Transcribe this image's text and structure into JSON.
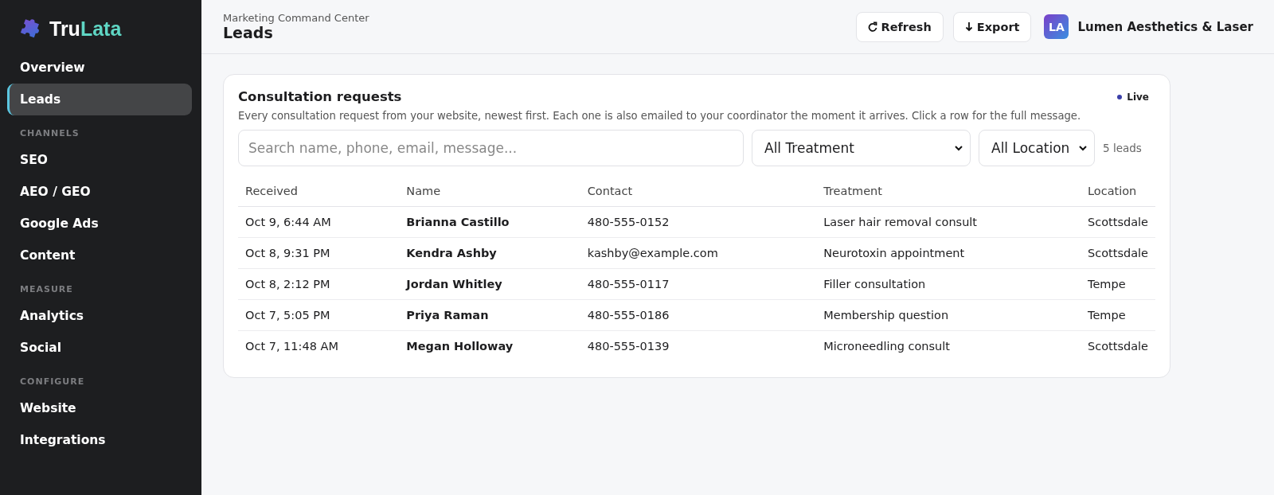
{
  "sidebar": {
    "logo_parts": [
      "Tru",
      "Lata"
    ],
    "sections": [
      {
        "items": [
          {
            "label": "Overview",
            "selected": false
          },
          {
            "label": "Leads",
            "selected": true
          }
        ]
      },
      {
        "heading": "CHANNELS",
        "items": [
          {
            "label": "SEO",
            "selected": false
          },
          {
            "label": "AEO / GEO",
            "selected": false
          },
          {
            "label": "Google Ads",
            "selected": false
          },
          {
            "label": "Content",
            "selected": false
          }
        ]
      },
      {
        "heading": "MEASURE",
        "items": [
          {
            "label": "Analytics",
            "selected": false
          },
          {
            "label": "Social",
            "selected": false
          }
        ]
      },
      {
        "heading": "CONFIGURE",
        "items": [
          {
            "label": "Website",
            "selected": false
          },
          {
            "label": "Integrations",
            "selected": false
          }
        ]
      }
    ]
  },
  "header": {
    "breadcrumb": "Marketing Command Center",
    "title": "Leads",
    "buttons": [
      {
        "kind": "refresh",
        "label": "Refresh"
      },
      {
        "kind": "export",
        "label": "Export"
      }
    ],
    "account": {
      "initials": "LA",
      "name": "Lumen Aesthetics & Laser"
    }
  },
  "card": {
    "title": "Consultation requests",
    "status": {
      "label": "Live",
      "color": "#3b3fa8"
    },
    "description": "Every consultation request from your website, newest first. Each one is also emailed to your coordinator the moment it arrives. Click a row for the full message.",
    "search": {
      "placeholder": "Search name, phone, email, message..."
    },
    "filters": [
      {
        "value": "All Treatment"
      },
      {
        "value": "All Location"
      }
    ],
    "count": "5 leads",
    "table": {
      "columns": [
        "Received",
        "Name",
        "Contact",
        "Treatment",
        "Location"
      ],
      "rows": [
        [
          "Oct 9, 6:44 AM",
          "Brianna Castillo",
          "480-555-0152",
          "Laser hair removal consult",
          "Scottsdale"
        ],
        [
          "Oct 8, 9:31 PM",
          "Kendra Ashby",
          "kashby@example.com",
          "Neurotoxin appointment",
          "Scottsdale"
        ],
        [
          "Oct 8, 2:12 PM",
          "Jordan Whitley",
          "480-555-0117",
          "Filler consultation",
          "Tempe"
        ],
        [
          "Oct 7, 5:05 PM",
          "Priya Raman",
          "480-555-0186",
          "Membership question",
          "Tempe"
        ],
        [
          "Oct 7, 11:48 AM",
          "Megan Holloway",
          "480-555-0139",
          "Microneedling consult",
          "Scottsdale"
        ]
      ]
    }
  }
}
